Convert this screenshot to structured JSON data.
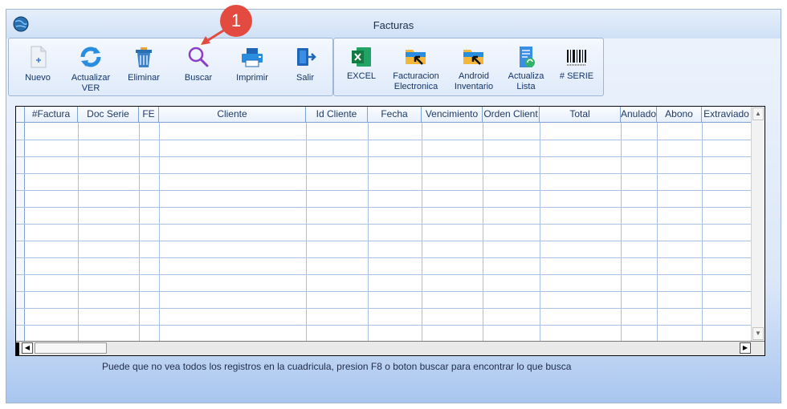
{
  "window": {
    "title": "Facturas"
  },
  "toolbar_main": [
    {
      "name": "nuevo-button",
      "icon": "new-document-icon",
      "label": "Nuevo"
    },
    {
      "name": "actualizar-ver-button",
      "icon": "refresh-icon",
      "label": "Actualizar\nVER"
    },
    {
      "name": "eliminar-button",
      "icon": "trash-icon",
      "label": "Eliminar"
    },
    {
      "name": "buscar-button",
      "icon": "search-icon",
      "label": "Buscar"
    },
    {
      "name": "imprimir-button",
      "icon": "printer-icon",
      "label": "Imprimir"
    },
    {
      "name": "salir-button",
      "icon": "exit-icon",
      "label": "Salir"
    }
  ],
  "toolbar_extra": [
    {
      "name": "excel-button",
      "icon": "excel-icon",
      "label": "EXCEL"
    },
    {
      "name": "facturacion-electronica-button",
      "icon": "folder-arrow-icon",
      "label": "Facturacion\nElectronica"
    },
    {
      "name": "android-inventario-button",
      "icon": "folder-arrow-icon",
      "label": "Android\nInventario"
    },
    {
      "name": "actualiza-lista-button",
      "icon": "document-refresh-icon",
      "label": "Actualiza\nLista"
    },
    {
      "name": "serie-button",
      "icon": "barcode-icon",
      "label": "# SERIE"
    }
  ],
  "grid": {
    "columns": [
      "#Factura",
      "Doc Serie",
      "FE",
      "Cliente",
      "Id Cliente",
      "Fecha",
      "Vencimiento",
      "Orden Client",
      "Total",
      "Anulado",
      "Abono",
      "Extraviado"
    ],
    "rows": []
  },
  "status_message": "Puede que no vea todos los registros en la cuadricula, presion F8 o boton buscar para encontrar lo que busca",
  "annotation": {
    "marker_number": "1"
  },
  "colors": {
    "accent": "#13356a",
    "marker": "#e34b40",
    "grid_line": "#a8c2e3"
  }
}
